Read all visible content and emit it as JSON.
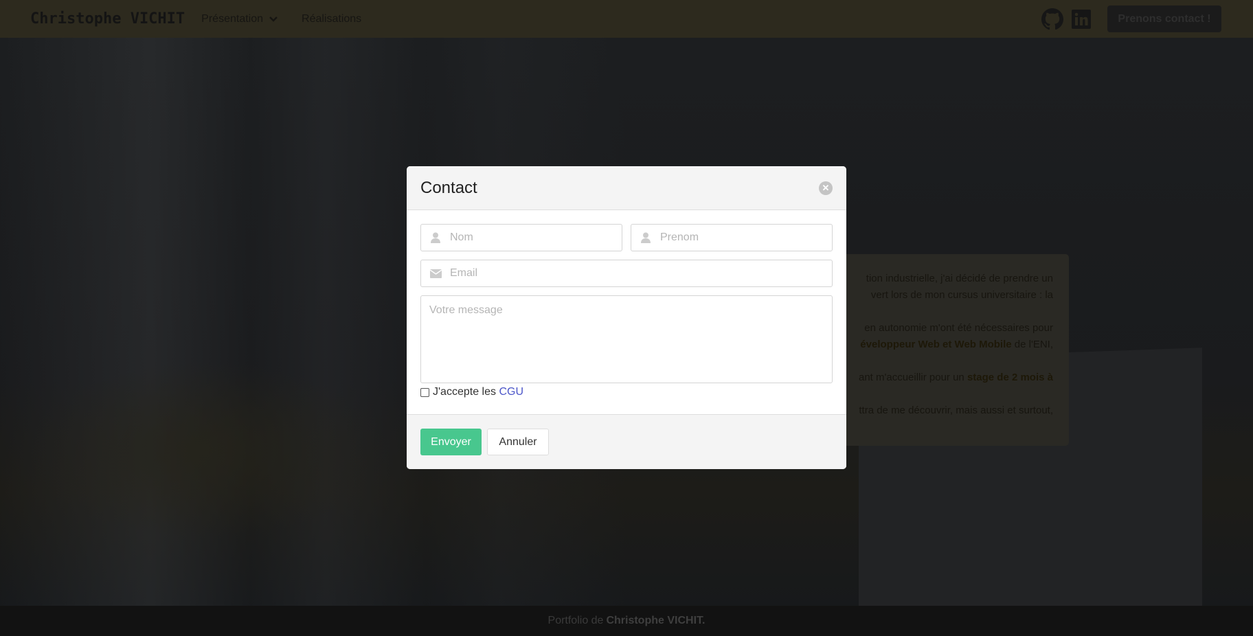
{
  "navbar": {
    "brand": "Christophe VICHIT",
    "links": [
      {
        "label": "Présentation",
        "has_dropdown": true
      },
      {
        "label": "Réalisations"
      }
    ],
    "icons": [
      "github-icon",
      "linkedin-icon"
    ],
    "cta": "Prenons contact !"
  },
  "background_card": {
    "lines": [
      {
        "text": "tion industrielle, j'ai décidé de prendre un"
      },
      {
        "text": "vert lors de mon cursus universitaire : la"
      },
      {
        "text": "en autonomie m'ont été nécessaires pour"
      },
      {
        "pre": "éveloppeur Web et Web Mobile",
        "text": " de l'ENI,"
      },
      {
        "text": "ant m'accueillir pour un ",
        "bold": "stage de 2 mois à"
      },
      {
        "text": "ttra de me découvrir, mais aussi et surtout,"
      }
    ]
  },
  "modal": {
    "title": "Contact",
    "fields": {
      "nom_placeholder": "Nom",
      "prenom_placeholder": "Prenom",
      "email_placeholder": "Email",
      "message_placeholder": "Votre message"
    },
    "cgu_label": "J'accepte les ",
    "cgu_link": "CGU",
    "cgu_checked": false,
    "submit": "Envoyer",
    "cancel": "Annuler",
    "accent": "#48c78e"
  },
  "footer": {
    "prefix": "Portfolio de",
    "name": "Christophe VICHIT."
  }
}
